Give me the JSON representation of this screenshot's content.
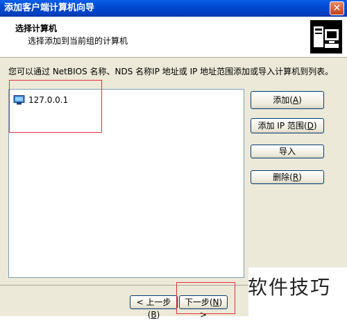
{
  "window": {
    "title": "添加客户端计算机向导",
    "close_label": "✕"
  },
  "header": {
    "title": "选择计算机",
    "subtitle": "选择添加到当前组的计算机",
    "icon": "computers-icon"
  },
  "description": "您可以通过 NetBIOS 名称、NDS 名称IP 地址或 IP 地址范围添加或导入计算机到列表。",
  "computer_list": {
    "items": [
      {
        "label": "127.0.0.1",
        "icon": "computer-icon"
      }
    ]
  },
  "buttons": {
    "add": {
      "label": "添加",
      "accel": "A"
    },
    "add_ip_range": {
      "label": "添加 IP 范围",
      "accel": "D"
    },
    "import": {
      "label": "导入"
    },
    "delete": {
      "label": "删除",
      "accel": "R"
    }
  },
  "footer": {
    "back": {
      "label": "< 上一步",
      "accel": "B"
    },
    "next": {
      "label": "下一步",
      "accel": "N"
    },
    "next_suffix": ">"
  },
  "watermark": "软件技巧",
  "colors": {
    "titlebar": "#0048d0",
    "highlight": "#e3303a",
    "dialog_bg": "#ece9d8"
  }
}
